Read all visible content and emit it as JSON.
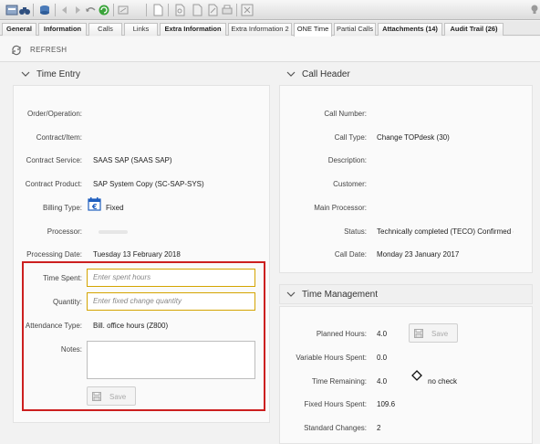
{
  "tabs": [
    {
      "label": "General",
      "bold": true
    },
    {
      "label": "Information",
      "bold": true
    },
    {
      "label": "Calls",
      "bold": false
    },
    {
      "label": "Links",
      "bold": false
    },
    {
      "label": "Extra Information",
      "bold": true
    },
    {
      "label": "Extra Information 2",
      "bold": false
    },
    {
      "label": "ONE Time",
      "bold": false,
      "active": true
    },
    {
      "label": "Partial Calls",
      "bold": false
    },
    {
      "label": "Attachments (14)",
      "bold": true
    },
    {
      "label": "Audit Trail (26)",
      "bold": true
    }
  ],
  "refresh_label": "REFRESH",
  "time_entry": {
    "title": "Time Entry",
    "order_label": "Order/Operation:",
    "contract_item_label": "Contract/Item:",
    "contract_service_label": "Contract Service:",
    "contract_service_value": "SAAS SAP (SAAS SAP)",
    "contract_product_label": "Contract Product:",
    "contract_product_value": "SAP System Copy (SC-SAP-SYS)",
    "billing_type_label": "Billing Type:",
    "billing_type_value": "Fixed",
    "processor_label": "Processor:",
    "processing_date_label": "Processing Date:",
    "processing_date_value": "Tuesday 13 February 2018",
    "time_spent_label": "Time Spent:",
    "time_spent_placeholder": "Enter spent hours",
    "quantity_label": "Quantity:",
    "quantity_placeholder": "Enter fixed change quantity",
    "attendance_type_label": "Attendance Type:",
    "attendance_type_value": "Bill. office hours (Z800)",
    "notes_label": "Notes:",
    "save_label": "Save"
  },
  "call_header": {
    "title": "Call Header",
    "call_number_label": "Call Number:",
    "call_type_label": "Call Type:",
    "call_type_value": "Change TOPdesk (30)",
    "description_label": "Description:",
    "customer_label": "Customer:",
    "main_processor_label": "Main Processor:",
    "status_label": "Status:",
    "status_value": "Technically completed (TECO) Confirmed (C(",
    "call_date_label": "Call Date:",
    "call_date_value": "Monday 23 January 2017"
  },
  "time_management": {
    "title": "Time Management",
    "planned_hours_label": "Planned Hours:",
    "planned_hours_value": "4.0",
    "save_label": "Save",
    "variable_hours_label": "Variable Hours Spent:",
    "variable_hours_value": "0.0",
    "time_remaining_label": "Time Remaining:",
    "time_remaining_value": "4.0",
    "check_label": "no check",
    "fixed_hours_label": "Fixed Hours Spent:",
    "fixed_hours_value": "109.6",
    "standard_changes_label": "Standard Changes:",
    "standard_changes_value": "2"
  },
  "colors": {
    "highlight": "#cc1f1f",
    "input_border": "#d4a400",
    "accent_blue": "#1f5fbf"
  }
}
